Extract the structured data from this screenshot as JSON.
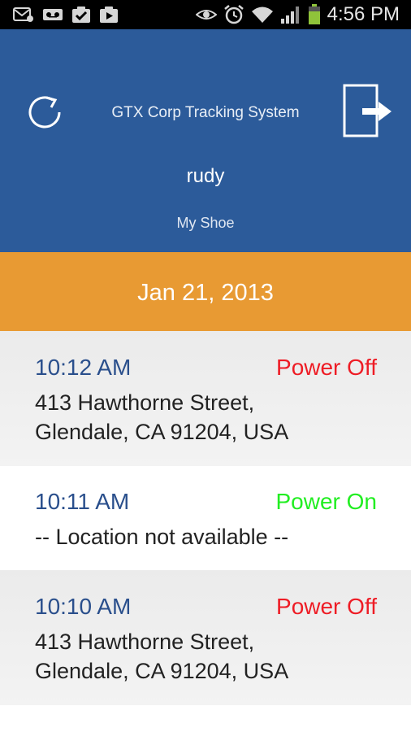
{
  "status_bar": {
    "time": "4:56 PM",
    "left_icons": [
      "email-icon",
      "voicemail-icon",
      "check-icon",
      "play-store-icon"
    ],
    "right_icons": [
      "eye-icon",
      "alarm-icon",
      "wifi-icon",
      "signal-icon",
      "battery-icon"
    ]
  },
  "header": {
    "app_title": "GTX Corp Tracking System",
    "user": "rudy",
    "device": "My Shoe",
    "refresh_icon": "refresh-icon",
    "exit_icon": "exit-icon",
    "bg_color": "#2c5b9a"
  },
  "date_bar": {
    "date": "Jan 21, 2013",
    "bg_color": "#e89a33"
  },
  "events": [
    {
      "time": "10:12 AM",
      "status": "Power Off",
      "address_line1": "413 Hawthorne Street,",
      "address_line2": "Glendale, CA 91204, USA"
    },
    {
      "time": "10:11 AM",
      "status": "Power On",
      "address_line1": "-- Location not available --",
      "address_line2": ""
    },
    {
      "time": "10:10 AM",
      "status": "Power Off",
      "address_line1": "413 Hawthorne Street,",
      "address_line2": "Glendale, CA 91204, USA"
    }
  ],
  "colors": {
    "power_off": "#ee1c25",
    "power_on": "#22ee22",
    "time_text": "#2a4f8c"
  }
}
